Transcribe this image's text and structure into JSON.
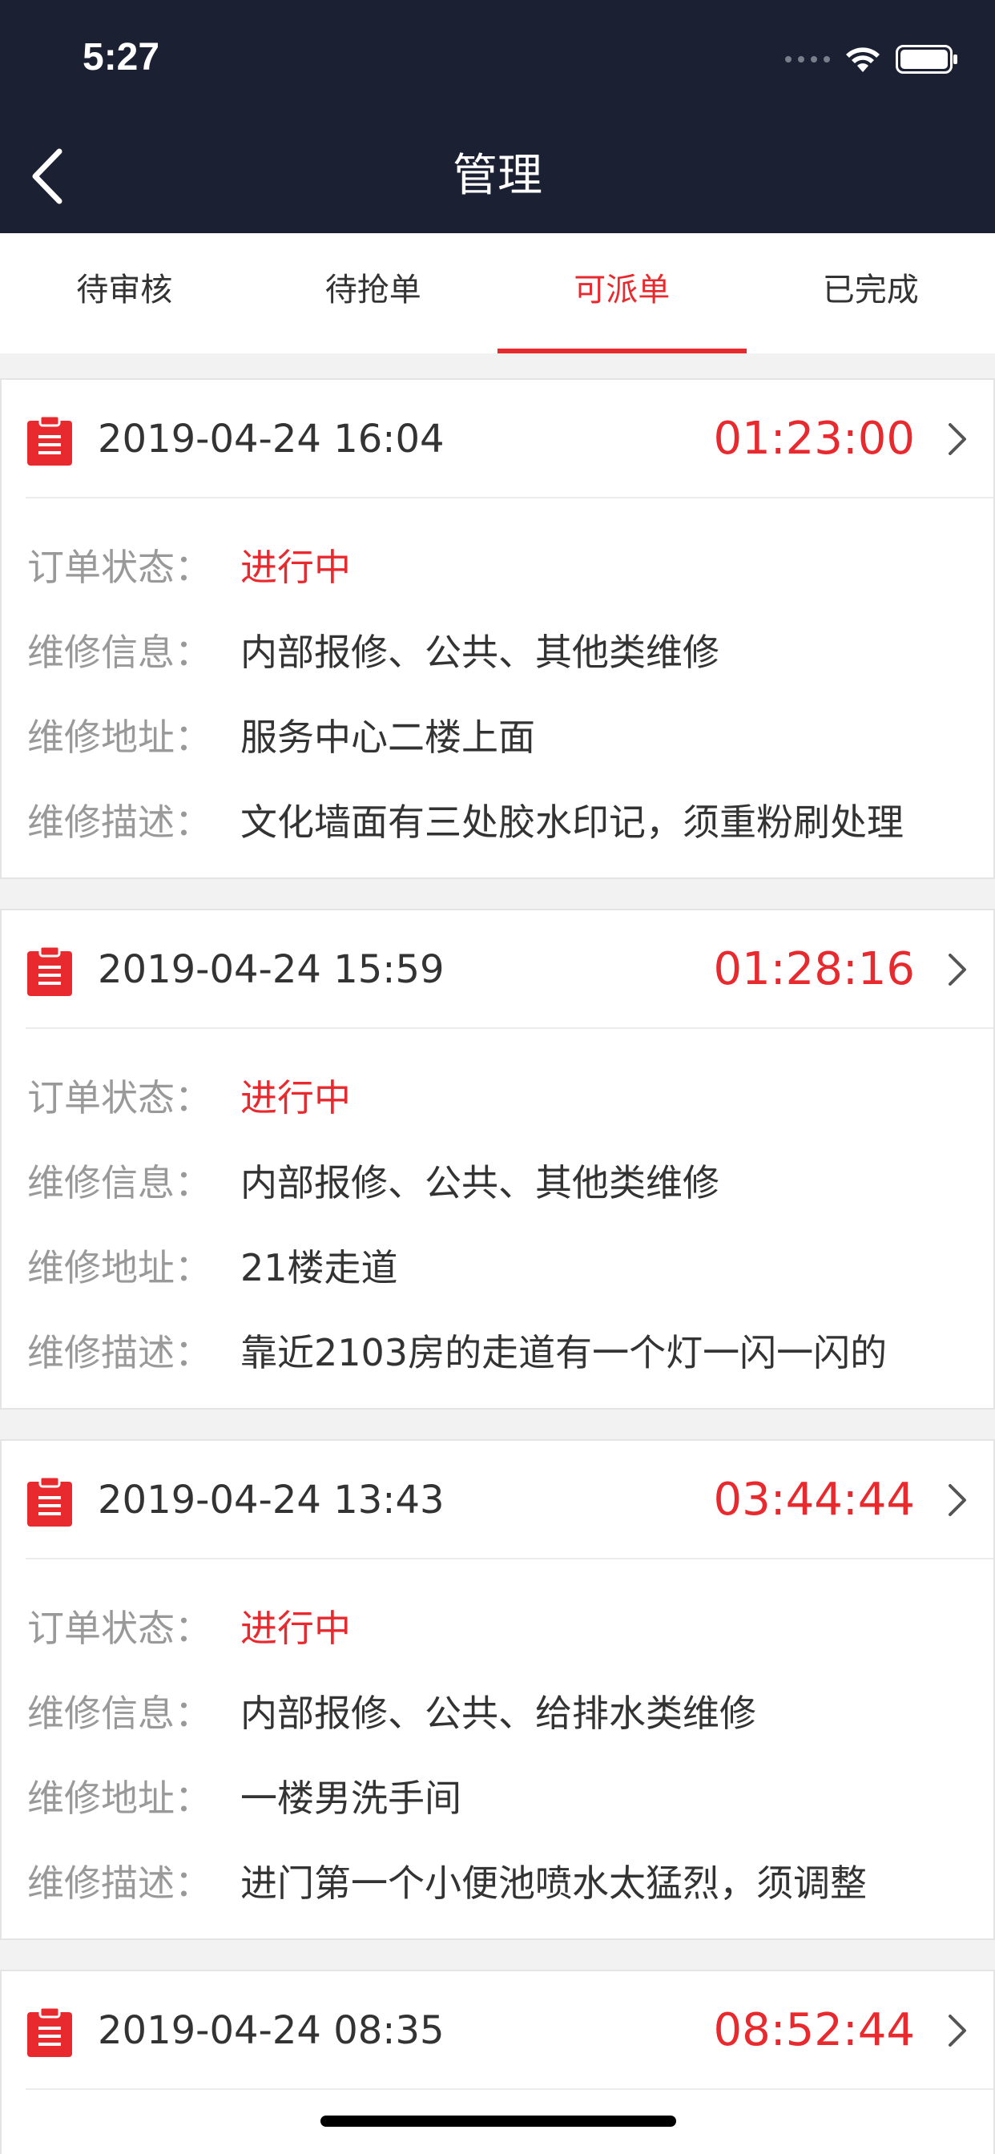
{
  "status_bar": {
    "time": "5:27"
  },
  "nav": {
    "title": "管理"
  },
  "tabs": [
    {
      "label": "待审核",
      "active": false
    },
    {
      "label": "待抢单",
      "active": false
    },
    {
      "label": "可派单",
      "active": true
    },
    {
      "label": "已完成",
      "active": false
    }
  ],
  "labels": {
    "status": "订单状态：",
    "info": "维修信息：",
    "address": "维修地址：",
    "desc": "维修描述："
  },
  "orders": [
    {
      "date": "2019-04-24 16:04",
      "timer": "01:23:00",
      "status": "进行中",
      "info": "内部报修、公共、其他类维修",
      "address": "服务中心二楼上面",
      "desc": "文化墙面有三处胶水印记，须重粉刷处理"
    },
    {
      "date": "2019-04-24 15:59",
      "timer": "01:28:16",
      "status": "进行中",
      "info": "内部报修、公共、其他类维修",
      "address": "21楼走道",
      "desc": "靠近2103房的走道有一个灯一闪一闪的"
    },
    {
      "date": "2019-04-24 13:43",
      "timer": "03:44:44",
      "status": "进行中",
      "info": "内部报修、公共、给排水类维修",
      "address": "一楼男洗手间",
      "desc": "进门第一个小便池喷水太猛烈，须调整"
    },
    {
      "date": "2019-04-24 08:35",
      "timer": "08:52:44"
    }
  ],
  "colors": {
    "header_bg": "#1c2033",
    "accent": "#e8292d"
  }
}
